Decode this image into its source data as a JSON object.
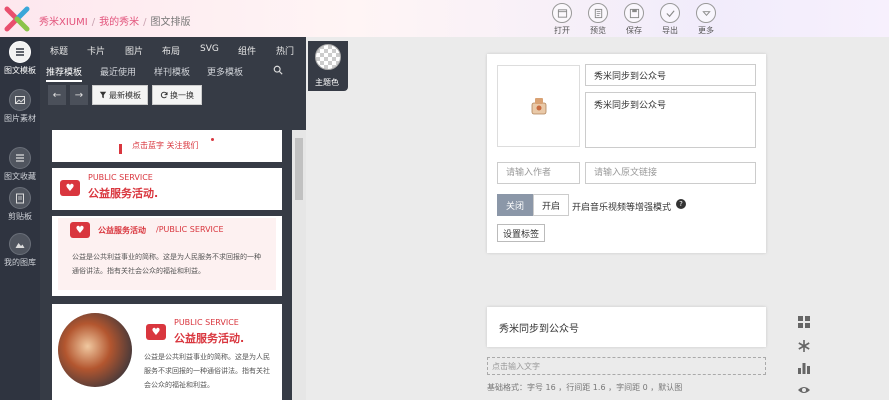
{
  "header": {
    "brand": "秀米XIUMI",
    "crumb_mine": "我的秀米",
    "crumb_current": "图文排版",
    "separator": "/",
    "tools": [
      {
        "label": "打开",
        "icon": "folder-icon"
      },
      {
        "label": "预览",
        "icon": "preview-icon"
      },
      {
        "label": "保存",
        "icon": "save-icon"
      },
      {
        "label": "导出",
        "icon": "export-check-icon"
      },
      {
        "label": "更多",
        "icon": "more-chevron-icon"
      }
    ]
  },
  "rail": {
    "items": [
      {
        "label": "图文模板",
        "icon": "layout-template-icon",
        "active": true
      },
      {
        "label": "图片素材",
        "icon": "image-icon",
        "active": false
      },
      {
        "label": "图文收藏",
        "icon": "list-icon",
        "active": false
      },
      {
        "label": "剪贴板",
        "icon": "clipboard-icon",
        "active": false
      },
      {
        "label": "我的图库",
        "icon": "gallery-icon",
        "active": false
      }
    ]
  },
  "panel": {
    "categories": [
      "标题",
      "卡片",
      "图片",
      "布局",
      "SVG",
      "组件",
      "热门"
    ],
    "theme_label": "主题色",
    "subtabs": [
      "推荐模板",
      "最近使用",
      "样刊模板",
      "更多模板"
    ],
    "active_subtab": 0,
    "back_arrow": "←",
    "forward_arrow": "→",
    "newest_btn": "最新模板",
    "swap_btn": "换一换",
    "templates": {
      "t1_text": "点击蓝字 关注我们",
      "t2_en": "PUBLIC SERVICE",
      "t2_cn": "公益服务活动.",
      "t3_title": "公益服务活动",
      "t3_en": "/PUBLIC SERVICE",
      "t3_body": "公益是公共利益事业的简称。这是为人民服务不求回报的一种通俗讲法。指有关社会公众的福祉和利益。",
      "t4_en": "PUBLIC SERVICE",
      "t4_cn": "公益服务活动.",
      "t4_body": "公益是公共利益事业的简称。这是为人民服务不求回报的一种通俗讲法。指有关社会公众的福祉和利益。"
    }
  },
  "editor": {
    "title_value": "秀米同步到公众号",
    "summary_value": "秀米同步到公众号",
    "author_placeholder": "请输入作者",
    "link_placeholder": "请输入原文链接",
    "off_label": "关闭",
    "on_label": "开启",
    "music_mode_label": "开启音乐视频等增强模式",
    "help_icon": "?",
    "tag_btn": "设置标签",
    "doc_title": "秀米同步到公众号",
    "text_hint": "点击输入文字",
    "basic_format": "基础格式：字号 16 ，行间距 1.6 ，字间距 0 ，默认图"
  },
  "colors": {
    "brand": "#e3547c",
    "dark_panel": "#363b45",
    "rail": "#2f3440",
    "accent_red": "#d9363e"
  }
}
